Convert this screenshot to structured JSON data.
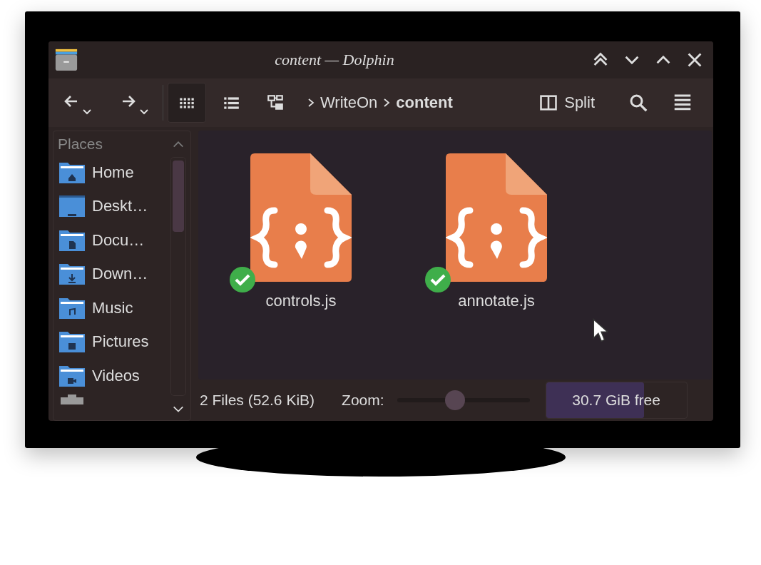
{
  "window": {
    "title": "content — Dolphin"
  },
  "toolbar": {
    "view_modes": [
      {
        "kind": "icons",
        "selected": true
      },
      {
        "kind": "details",
        "selected": false
      },
      {
        "kind": "tree",
        "selected": false
      }
    ],
    "breadcrumb": [
      "WriteOn",
      "content"
    ],
    "split": {
      "label": "Split"
    }
  },
  "places": {
    "title": "Places",
    "items": [
      {
        "label": "Home",
        "kind": "home"
      },
      {
        "label": "Deskt…",
        "kind": "desktop"
      },
      {
        "label": "Docu…",
        "kind": "documents"
      },
      {
        "label": "Down…",
        "kind": "downloads"
      },
      {
        "label": "Music",
        "kind": "music"
      },
      {
        "label": "Pictures",
        "kind": "pictures"
      },
      {
        "label": "Videos",
        "kind": "videos"
      }
    ]
  },
  "files": [
    {
      "name": "controls.js",
      "synced": true
    },
    {
      "name": "annotate.js",
      "synced": true
    }
  ],
  "status_bar": {
    "summary": "2 Files (52.6 KiB)",
    "zoom_label": "Zoom:",
    "zoom": {
      "level": 0.44
    },
    "free_space": {
      "label": "30.7 GiB free",
      "level": 0.7
    }
  }
}
